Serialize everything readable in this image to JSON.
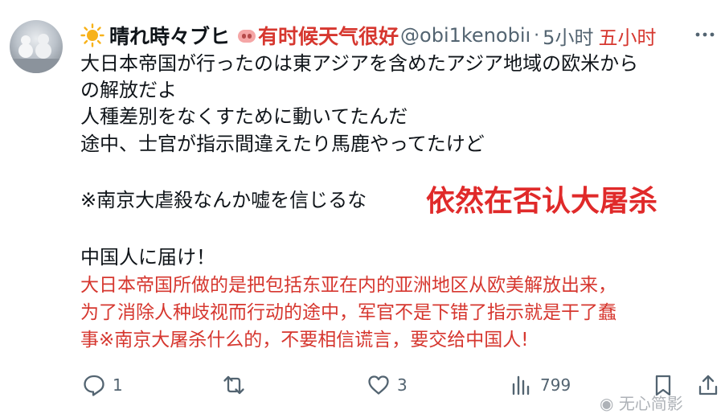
{
  "post": {
    "display_name": "晴れ時々ブヒ",
    "name_translation": "有时候天气很好",
    "handle": "@obi1kenobiı",
    "separator": "·",
    "time": "5小时",
    "time_translation": "五小时",
    "lines": [
      "大日本帝国が行ったのは東アジアを含めたアジア地域の欧米から",
      "の解放だよ",
      "人種差別をなくすために動いてたんだ",
      "途中、士官が指示間違えたり馬鹿やってたけど",
      "※南京大虐殺なんか嘘を信じるな",
      "中国人に届け！"
    ],
    "annotation": "依然在否认大屠杀",
    "translation_lines": [
      "大日本帝国所做的是把包括东亚在内的亚洲地区从欧美解放出来，",
      "为了消除人种歧视而行动的途中，军官不是下错了指示就是干了蠢",
      "事※南京大屠杀什么的，不要相信谎言，要交给中国人!"
    ]
  },
  "actions": {
    "reply_icon": "reply-icon",
    "reply_count": "1",
    "retweet_icon": "retweet-icon",
    "like_icon": "heart-icon",
    "like_count": "3",
    "views_icon": "bar-chart-icon",
    "views_count": "799",
    "bookmark_icon": "bookmark-icon",
    "share_icon": "share-icon"
  },
  "watermark": "无心简影"
}
